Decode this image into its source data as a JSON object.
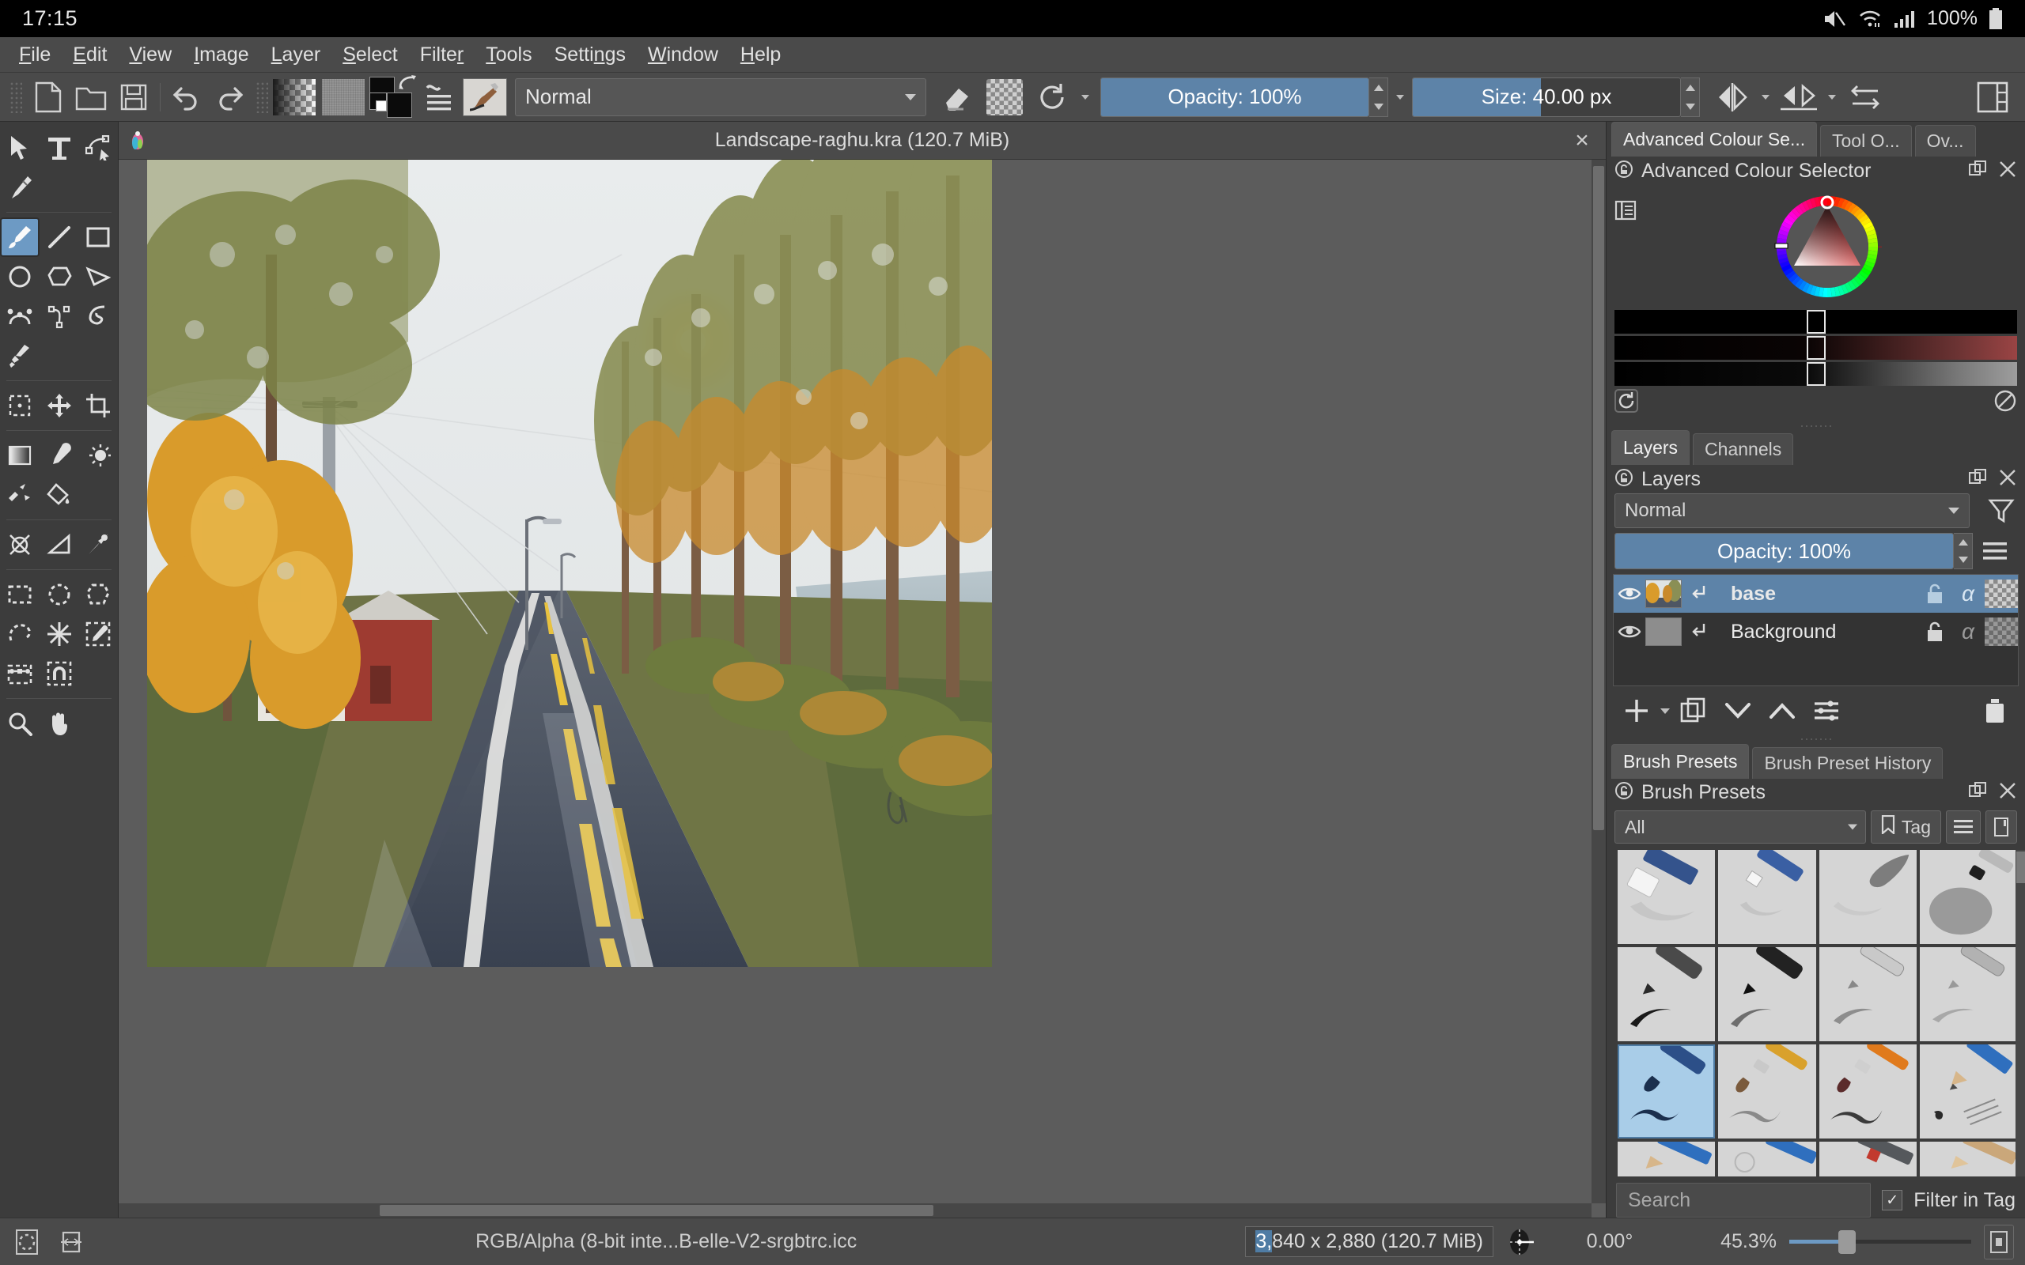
{
  "os_bar": {
    "clock": "17:15",
    "battery_text": "100%",
    "icons": [
      "mute-icon",
      "wifi-icon",
      "signal-icon",
      "battery-icon"
    ]
  },
  "menubar": {
    "items": [
      {
        "label": "File",
        "accel": "F"
      },
      {
        "label": "Edit",
        "accel": "E"
      },
      {
        "label": "View",
        "accel": "V"
      },
      {
        "label": "Image",
        "accel": "I"
      },
      {
        "label": "Layer",
        "accel": "L"
      },
      {
        "label": "Select",
        "accel": "S"
      },
      {
        "label": "Filter",
        "accel": "r"
      },
      {
        "label": "Tools",
        "accel": "T"
      },
      {
        "label": "Settings",
        "accel": "n"
      },
      {
        "label": "Window",
        "accel": "W"
      },
      {
        "label": "Help",
        "accel": "H"
      }
    ]
  },
  "toolbar": {
    "new_label": "New",
    "open_label": "Open",
    "save_label": "Save",
    "undo_label": "Undo",
    "redo_label": "Redo",
    "gradient_label": "Gradients",
    "pattern_label": "Patterns",
    "fg_color": "#0b0b0b",
    "bg_color": "#0b0b0b",
    "blending_mode": "Normal",
    "eraser_label": "Eraser mode",
    "alpha_label": "Preserve alpha",
    "reload_label": "Reload preset",
    "opacity_label": "Opacity: 100%",
    "opacity_fill_pct": 100,
    "size_label": "Size: 40.00 px",
    "size_fill_pct": 48,
    "mirror_h_label": "Horizontal mirror",
    "mirror_v_label": "Vertical mirror",
    "wrap_label": "Wrap around mode",
    "workspace_label": "Choose workspace"
  },
  "toolbox": {
    "selected": "freehand-brush",
    "groups": [
      [
        "select-shapes-tool",
        "text-tool",
        "edit-shapes-tool"
      ],
      [
        "calligraphy-tool"
      ],
      [
        "freehand-brush-tool",
        "line-tool",
        "rectangle-tool"
      ],
      [
        "ellipse-tool",
        "polygon-tool",
        "polyline-tool"
      ],
      [
        "bezier-curve-tool",
        "freehand-path-tool",
        "dynamic-brush-tool"
      ],
      [
        "multibrush-tool"
      ],
      [
        "transform-tool",
        "move-tool",
        "crop-tool"
      ],
      [
        "gradient-tool",
        "colour-sampler-tool",
        "colourize-mask-tool"
      ],
      [
        "smart-patch-tool",
        "fill-tool"
      ],
      [
        "assistant-tool",
        "measure-tool",
        "reference-images-tool"
      ],
      [
        "rectangular-select-tool",
        "elliptical-select-tool",
        "polygonal-select-tool"
      ],
      [
        "freehand-select-tool",
        "magic-wand-select-tool",
        "similar-colour-select-tool"
      ],
      [
        "bezier-select-tool",
        "magnetic-select-tool"
      ],
      [
        "zoom-tool",
        "pan-tool"
      ]
    ]
  },
  "document": {
    "title": "Landscape-raghu.kra (120.7 MiB)",
    "close_label": "×",
    "artwork_alt": "Autumn roadside landscape digital painting"
  },
  "right_dock": {
    "top_tabs": [
      {
        "label": "Advanced Colour Se...",
        "active": true
      },
      {
        "label": "Tool O...",
        "active": false
      },
      {
        "label": "Ov...",
        "active": false
      }
    ],
    "colour_selector": {
      "title": "Advanced Colour Selector",
      "settings_label": "Selector settings",
      "reset_label": "Reset to default",
      "clear_label": "Clear colour history",
      "shade_rows": 3
    },
    "layers_tabs": [
      {
        "label": "Layers",
        "active": true
      },
      {
        "label": "Channels",
        "active": false
      }
    ],
    "layers": {
      "title": "Layers",
      "blend_mode": "Normal",
      "opacity_label": "Opacity:  100%",
      "opacity_fill_pct": 100,
      "filter_label": "Filter layers",
      "menu_label": "Layer options",
      "rows": [
        {
          "name": "base",
          "selected": true,
          "visible": true,
          "locked": false,
          "alpha": "α"
        },
        {
          "name": "Background",
          "selected": false,
          "visible": true,
          "locked": true,
          "alpha": "α"
        }
      ],
      "buttons": [
        {
          "name": "add-layer-button",
          "label": "+"
        },
        {
          "name": "duplicate-layer-button",
          "label": "Duplicate"
        },
        {
          "name": "move-layer-down-button",
          "label": "Down"
        },
        {
          "name": "move-layer-up-button",
          "label": "Up"
        },
        {
          "name": "layer-properties-button",
          "label": "Properties"
        },
        {
          "name": "delete-layer-button",
          "label": "Delete"
        }
      ]
    },
    "brush_tabs": [
      {
        "label": "Brush Presets",
        "active": true
      },
      {
        "label": "Brush Preset History",
        "active": false
      }
    ],
    "brush_presets": {
      "title": "Brush Presets",
      "tag_filter": "All",
      "tag_button": "Tag",
      "search_placeholder": "Search",
      "filter_in_tag_label": "Filter in Tag",
      "filter_in_tag_checked": true,
      "check_glyph": "✓",
      "selected_index": 8,
      "cells": [
        {
          "kind": "eraser-soft"
        },
        {
          "kind": "eraser-small"
        },
        {
          "kind": "eraser-smudge"
        },
        {
          "kind": "airbrush-soft"
        },
        {
          "kind": "ink-pen-dark"
        },
        {
          "kind": "ink-pen-black"
        },
        {
          "kind": "ink-pen-fine"
        },
        {
          "kind": "ink-pen-grey"
        },
        {
          "kind": "ink-brush-blue"
        },
        {
          "kind": "brush-tan"
        },
        {
          "kind": "brush-orange"
        },
        {
          "kind": "pencil-blue"
        },
        {
          "kind": "pencil-blue-2"
        },
        {
          "kind": "pencil-blue-3"
        },
        {
          "kind": "pencil-dark"
        },
        {
          "kind": "pencil-wood"
        }
      ]
    }
  },
  "status_bar": {
    "selection_mask_label": "Selection mask",
    "canvas_mode_label": "Canvas mode",
    "colour_space": "RGB/Alpha (8-bit inte...B-elle-V2-srgbtrc.icc",
    "dimensions_prefix": "3,",
    "dimensions_rest": "840 x 2,880 (120.7 MiB)",
    "rotation": "0.00°",
    "zoom": "45.3%",
    "zoom_fill_pct": 30,
    "preview_label": "Fit page"
  }
}
